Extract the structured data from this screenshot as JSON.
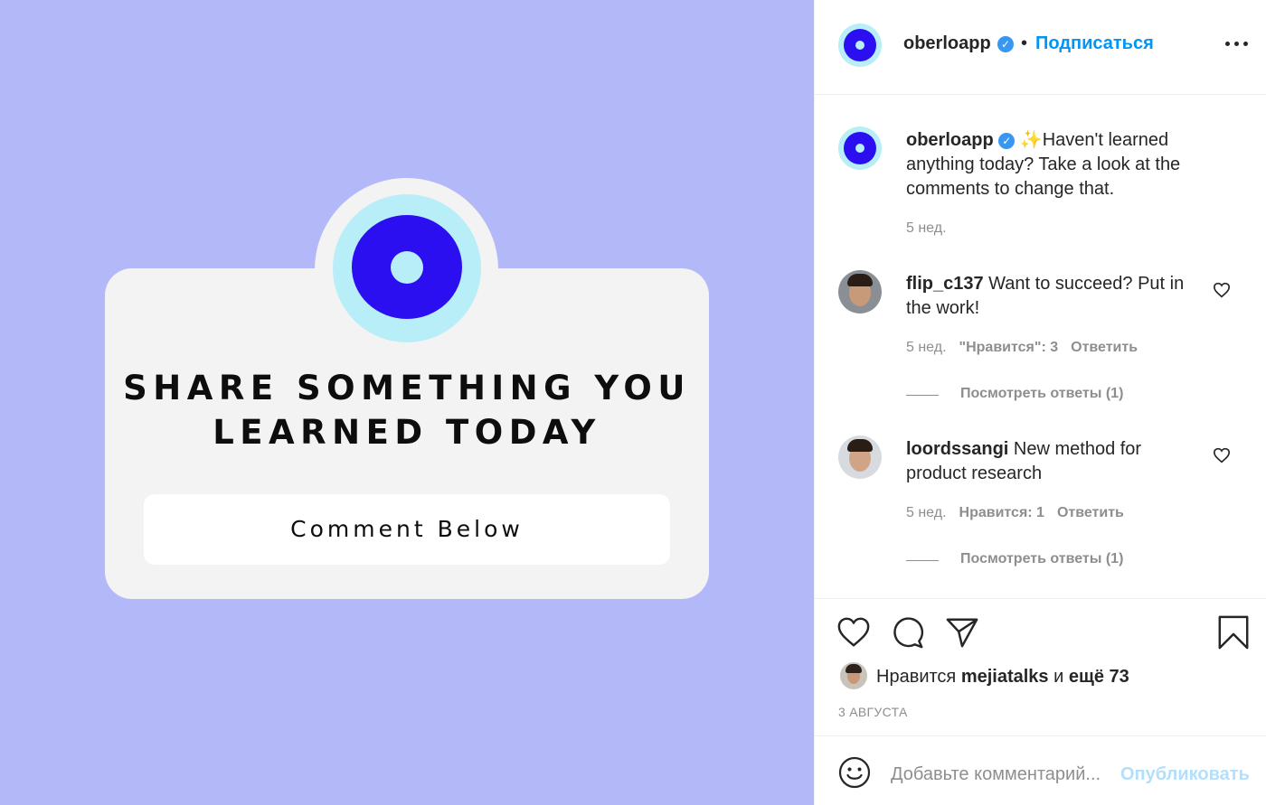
{
  "post_image": {
    "title_line1": "SHARE SOMETHING YOU",
    "title_line2": "LEARNED TODAY",
    "button_label": "Comment Below",
    "background": "#b3b8f9",
    "logo_color": "#2b0ff0",
    "logo_ring": "#b7eef8"
  },
  "header": {
    "username": "oberloapp",
    "dot": "•",
    "follow_label": "Подписаться"
  },
  "caption": {
    "username": "oberloapp",
    "emoji": "✨",
    "text": "Haven't learned anything today? Take a look at the comments to change that.",
    "time": "5 нед."
  },
  "comments": [
    {
      "username": "flip_c137",
      "text": "Want to succeed? Put in the work!",
      "time": "5 нед.",
      "likes": "\"Нравится\": 3",
      "reply_label": "Ответить",
      "view_replies": "Посмотреть ответы (1)"
    },
    {
      "username": "loordssangi",
      "text": "New method for product research",
      "time": "5 нед.",
      "likes": "Нравится: 1",
      "reply_label": "Ответить",
      "view_replies": "Посмотреть ответы (1)"
    }
  ],
  "likes": {
    "prefix": "Нравится",
    "user": "mejiatalks",
    "conj": "и",
    "more": "ещё 73"
  },
  "date": "3 АВГУСТА",
  "comment_form": {
    "placeholder": "Добавьте комментарий...",
    "publish_label": "Опубликовать"
  },
  "colors": {
    "link_blue": "#0095f6",
    "publish_disabled": "#b2dffc",
    "verified": "#3897f0",
    "muted": "#8e8e8e"
  }
}
